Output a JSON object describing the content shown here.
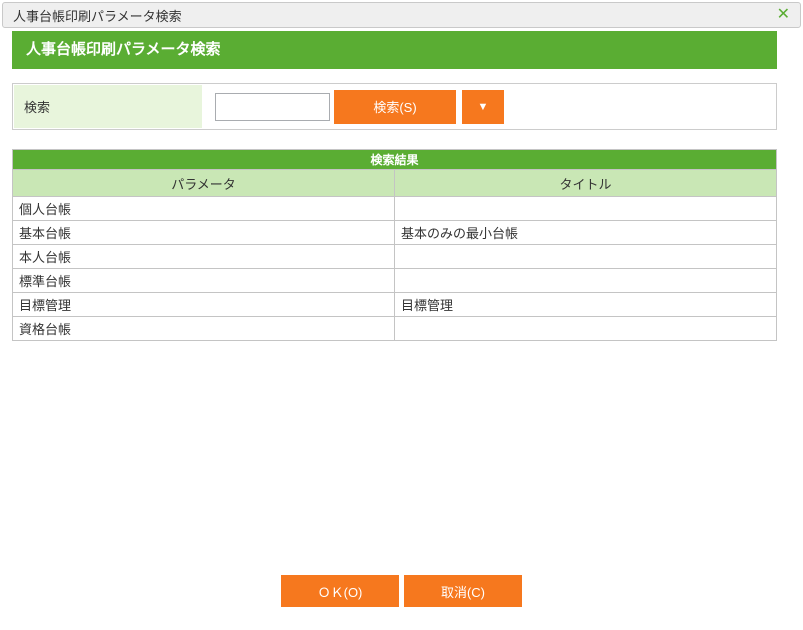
{
  "window": {
    "title": "人事台帳印刷パラメータ検索",
    "close_icon": "✕"
  },
  "header": {
    "title": "人事台帳印刷パラメータ検索"
  },
  "search": {
    "label": "検索",
    "input_value": "",
    "search_button": "検索(S)",
    "dropdown_icon": "▼"
  },
  "results": {
    "title": "検索結果",
    "columns": [
      "パラメータ",
      "タイトル"
    ],
    "rows": [
      {
        "param": "個人台帳",
        "title": ""
      },
      {
        "param": "基本台帳",
        "title": "基本のみの最小台帳"
      },
      {
        "param": "本人台帳",
        "title": ""
      },
      {
        "param": "標準台帳",
        "title": ""
      },
      {
        "param": "目標管理",
        "title": "目標管理"
      },
      {
        "param": "資格台帳",
        "title": ""
      }
    ]
  },
  "footer": {
    "ok_button": "ＯＫ(O)",
    "cancel_button": "取消(C)"
  },
  "colors": {
    "accent_green": "#5aad33",
    "pale_green": "#e8f5dc",
    "header_light_green": "#c9e7b5",
    "accent_orange": "#f6781e",
    "titlebar_gray": "#efefef"
  }
}
